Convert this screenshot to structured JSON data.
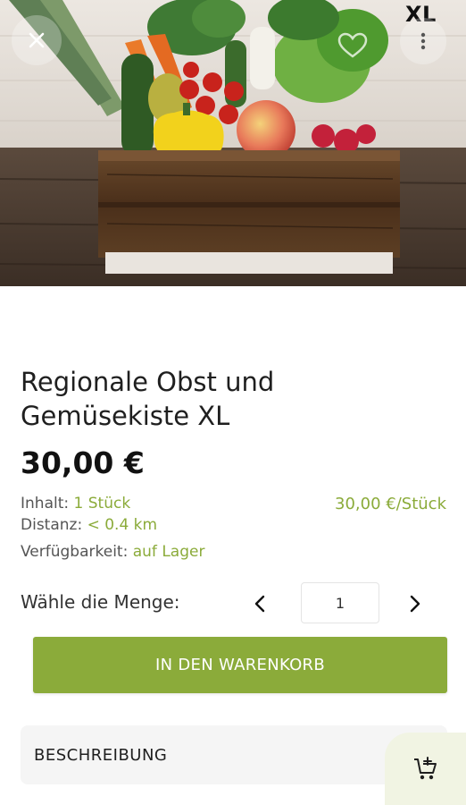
{
  "hero": {
    "badge": "XL",
    "close_icon": "close-icon",
    "more_icon": "more-vertical-icon",
    "favorite_icon": "heart-icon"
  },
  "product": {
    "title": "Regionale Obst und Gemüsekiste XL",
    "price": "30,00 €",
    "content_label": "Inhalt:",
    "content_value": "1 Stück",
    "unit_price": "30,00 €/Stück",
    "distance_label": "Distanz:",
    "distance_value": "< 0.4 km",
    "availability_label": "Verfügbarkeit:",
    "availability_value": "auf Lager"
  },
  "quantity": {
    "label": "Wähle die Menge:",
    "value": "1",
    "decrease_icon": "chevron-left-icon",
    "increase_icon": "chevron-right-icon"
  },
  "actions": {
    "add_to_cart": "IN DEN WARENKORB"
  },
  "description": {
    "label": "BESCHREIBUNG"
  },
  "fab": {
    "icon": "add-to-cart-icon"
  },
  "colors": {
    "accent": "#8bab3a",
    "text": "#1f1f1f",
    "muted": "#555555",
    "panel": "#f5f5f5",
    "fab_bg": "#f1f4e3"
  }
}
